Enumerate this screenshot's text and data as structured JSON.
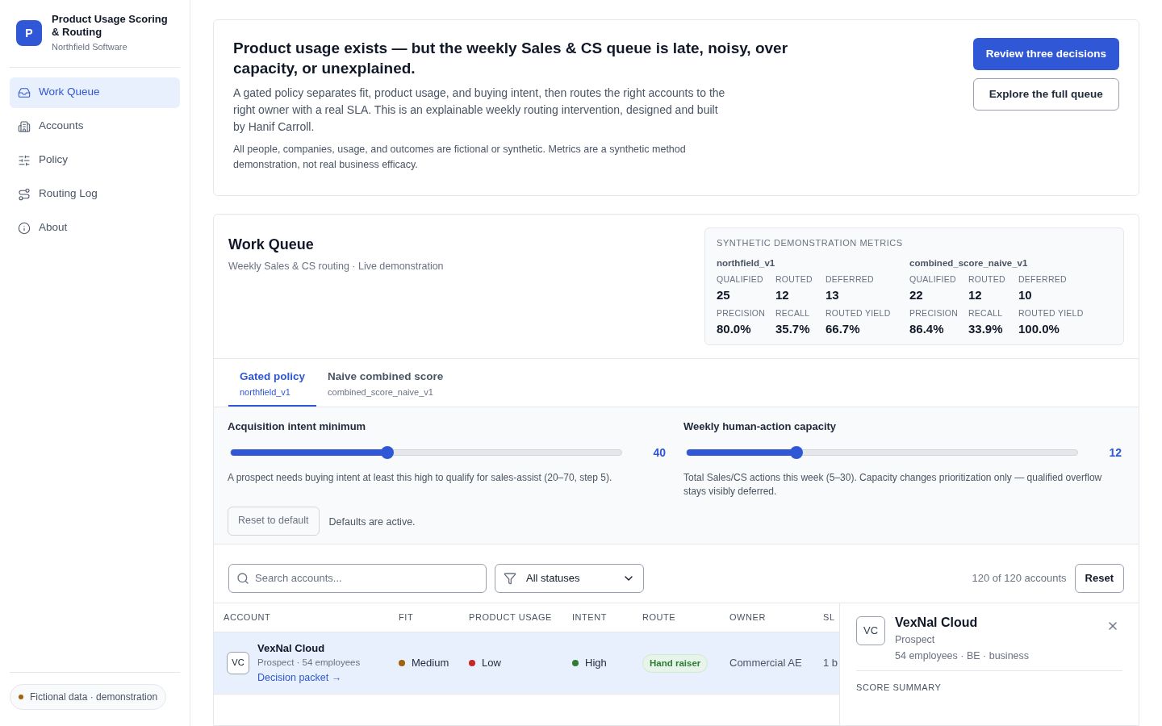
{
  "sidebar": {
    "logo": "P",
    "title": "Product Usage Scoring & Routing",
    "subtitle": "Northfield Software",
    "items": [
      {
        "label": "Work Queue",
        "kind": "inbox",
        "selected": true
      },
      {
        "label": "Accounts",
        "kind": "building",
        "selected": false
      },
      {
        "label": "Policy",
        "kind": "sliders",
        "selected": false
      },
      {
        "label": "Routing Log",
        "kind": "route",
        "selected": false
      },
      {
        "label": "About",
        "kind": "info",
        "selected": false
      }
    ],
    "footer_badge": "Fictional data · demonstration"
  },
  "hero": {
    "title": "Product usage exists — but the weekly Sales & CS queue is late, noisy, over capacity, or unexplained.",
    "body": "A gated policy separates fit, product usage, and buying intent, then routes the right accounts to the right owner with a real SLA. This is an explainable weekly routing intervention, designed and built by Hanif Carroll.",
    "note": "All people, companies, usage, and outcomes are fictional or synthetic. Metrics are a synthetic method demonstration, not real business efficacy.",
    "primary_button": "Review three decisions",
    "secondary_button": "Explore the full queue"
  },
  "work_queue": {
    "title": "Work Queue",
    "subtitle": "Weekly Sales & CS routing · Live demonstration",
    "metrics": {
      "heading": "SYNTHETIC DEMONSTRATION METRICS",
      "policies": [
        {
          "name": "northfield_v1",
          "stats": [
            {
              "label": "QUALIFIED",
              "value": "25"
            },
            {
              "label": "ROUTED",
              "value": "12"
            },
            {
              "label": "DEFERRED",
              "value": "13"
            },
            {
              "label": "PRECISION",
              "value": "80.0%"
            },
            {
              "label": "RECALL",
              "value": "35.7%"
            },
            {
              "label": "ROUTED YIELD",
              "value": "66.7%"
            }
          ]
        },
        {
          "name": "combined_score_naive_v1",
          "stats": [
            {
              "label": "QUALIFIED",
              "value": "22"
            },
            {
              "label": "ROUTED",
              "value": "12"
            },
            {
              "label": "DEFERRED",
              "value": "10"
            },
            {
              "label": "PRECISION",
              "value": "86.4%"
            },
            {
              "label": "RECALL",
              "value": "33.9%"
            },
            {
              "label": "ROUTED YIELD",
              "value": "100.0%"
            }
          ]
        }
      ]
    },
    "tabs": [
      {
        "label": "Gated policy",
        "sublabel": "northfield_v1",
        "selected": true
      },
      {
        "label": "Naive combined score",
        "sublabel": "combined_score_naive_v1",
        "selected": false
      }
    ],
    "sliders": [
      {
        "label": "Acquisition intent minimum",
        "level": 0.4,
        "reading": "40",
        "help": "A prospect needs buying intent at least this high to qualify for sales-assist (20–70, step 5)."
      },
      {
        "label": "Weekly human-action capacity",
        "level": 0.28,
        "reading": "12",
        "help": "Total Sales/CS actions this week (5–30). Capacity changes prioritization only — qualified overflow stays visibly deferred."
      }
    ],
    "reset_default_button": "Reset to default",
    "reset_default_disabled": true,
    "defaults_note": "Defaults are active.",
    "search": {
      "placeholder": "Search accounts..."
    },
    "status_filter": "All statuses",
    "count": "120 of 120 accounts",
    "reset_button": "Reset",
    "table": {
      "columns": [
        "ACCOUNT",
        "FIT",
        "PRODUCT USAGE",
        "INTENT",
        "ROUTE",
        "OWNER",
        "SL"
      ],
      "rows": [
        {
          "selected": true,
          "initials": "VC",
          "name": "VexNal Cloud",
          "meta": "Prospect · 54 employees",
          "link": "Decision packet →",
          "fit": {
            "label": "Medium",
            "color": "#a1620e"
          },
          "usage": {
            "label": "Low",
            "color": "#c62828"
          },
          "intent": {
            "label": "High",
            "color": "#2e7d32"
          },
          "route": "Hand raiser",
          "owner": "Commercial AE",
          "sla": "1 b"
        }
      ]
    },
    "detail": {
      "initials": "VC",
      "name": "VexNal Cloud",
      "type": "Prospect",
      "meta": "54 employees · BE · business",
      "section": "SCORE SUMMARY"
    }
  }
}
